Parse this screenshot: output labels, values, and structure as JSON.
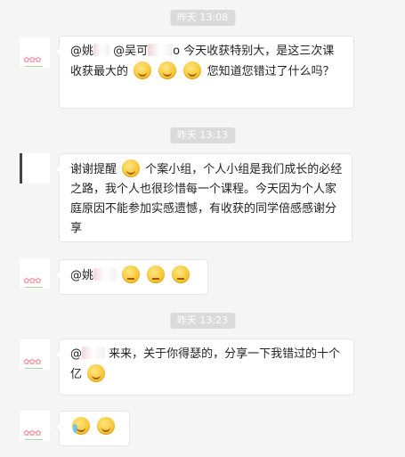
{
  "timestamps": [
    "昨天 13:08",
    "昨天 13:13",
    "昨天 13:23"
  ],
  "messages": [
    {
      "part1": "@姚",
      "part2": "@吴可",
      "part3": "o 今天收获特别大，是这三次课收获最大的",
      "part4": "您知道您错过了什么吗？"
    },
    {
      "part1": "谢谢提醒",
      "part2": "个案小组，个人小组是我们成长的必经之路，我个人也很珍惜每一个课程。今天因为个人家庭原因不能参加实感遗憾，有收获的同学倍感感谢分享"
    },
    {
      "part1": "@姚"
    },
    {
      "part1": "@",
      "part2": "来来，关于你得瑟的，分享一下我错过的十个亿"
    }
  ],
  "icons": {
    "grin": "grin-emoji-icon",
    "smile": "smile-emoji-icon",
    "think": "thinking-emoji-icon",
    "cry": "crying-emoji-icon",
    "grimace": "grimace-emoji-icon"
  }
}
